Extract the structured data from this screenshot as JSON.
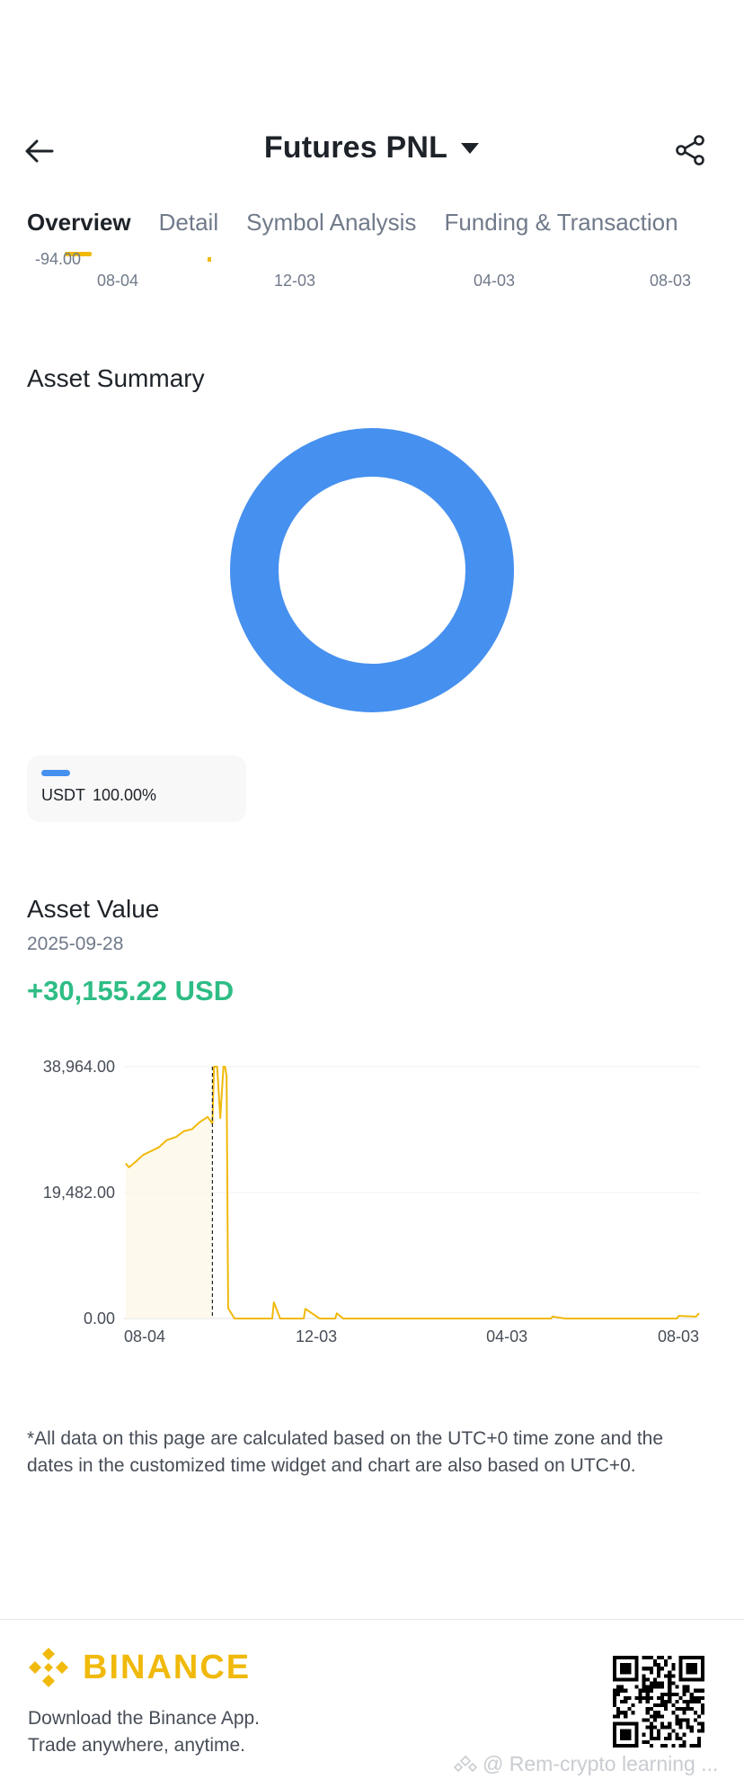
{
  "header": {
    "title": "Futures PNL",
    "back_icon": "arrow-left-icon",
    "dropdown_icon": "caret-down-icon",
    "share_icon": "share-icon"
  },
  "tabs": [
    {
      "label": "Overview",
      "active": true
    },
    {
      "label": "Detail",
      "active": false
    },
    {
      "label": "Symbol Analysis",
      "active": false
    },
    {
      "label": "Funding & Transaction",
      "active": false
    }
  ],
  "top_chart": {
    "y_label": "-94.00",
    "x_ticks": [
      "08-04",
      "12-03",
      "04-03",
      "08-03"
    ]
  },
  "asset_summary": {
    "title": "Asset Summary",
    "legend": [
      {
        "asset": "USDT",
        "percent": "100.00%",
        "color": "#4690ef"
      }
    ]
  },
  "asset_value": {
    "title": "Asset Value",
    "date": "2025-09-28",
    "value": "+30,155.22 USD"
  },
  "chart_data": [
    {
      "type": "pie",
      "categories": [
        "USDT"
      ],
      "values": [
        100
      ],
      "colors": [
        "#4690ef"
      ],
      "donut": true
    },
    {
      "type": "line",
      "y_tick_labels": [
        "38,964.00",
        "19,482.00",
        "0.00"
      ],
      "x_tick_labels": [
        "08-04",
        "12-03",
        "04-03",
        "08-03"
      ],
      "ylim": [
        0,
        38964
      ],
      "x": [
        "2024-08-04",
        "2024-08-06",
        "2024-08-10",
        "2024-08-15",
        "2024-08-20",
        "2024-08-25",
        "2024-08-30",
        "2024-09-05",
        "2024-09-10",
        "2024-09-15",
        "2024-09-20",
        "2024-09-25",
        "2024-09-28",
        "2024-09-29",
        "2024-10-01",
        "2024-10-03",
        "2024-10-05",
        "2024-10-06",
        "2024-10-07",
        "2024-10-08",
        "2024-10-12",
        "2024-10-20",
        "2024-10-30",
        "2024-11-05",
        "2024-11-06",
        "2024-11-10",
        "2024-11-25",
        "2024-11-26",
        "2024-12-05",
        "2024-12-15",
        "2024-12-16",
        "2024-12-20",
        "2025-01-15",
        "2025-03-01",
        "2025-04-01",
        "2025-05-01",
        "2025-05-02",
        "2025-05-10",
        "2025-06-01",
        "2025-07-01",
        "2025-07-20",
        "2025-07-21",
        "2025-08-01",
        "2025-08-03"
      ],
      "values": [
        24000,
        23400,
        24200,
        25300,
        25900,
        26500,
        27600,
        28100,
        29000,
        29300,
        30400,
        31200,
        30155,
        38964,
        38964,
        31000,
        38964,
        38964,
        37500,
        1600,
        0,
        0,
        0,
        0,
        2500,
        0,
        0,
        1500,
        0,
        0,
        800,
        0,
        0,
        0,
        0,
        0,
        300,
        0,
        0,
        0,
        0,
        400,
        300,
        800
      ],
      "marker_date": "2024-09-28",
      "line_color": "#f0b90b",
      "grid": true
    }
  ],
  "note": "*All data on this page are calculated based on the UTC+0 time zone and the dates in the customized time widget and chart are also based on UTC+0.",
  "footer": {
    "brand": "BINANCE",
    "line1": "Download the Binance App.",
    "line2": "Trade anywhere, anytime.",
    "watermark": "@ Rem-crypto learning ..."
  }
}
